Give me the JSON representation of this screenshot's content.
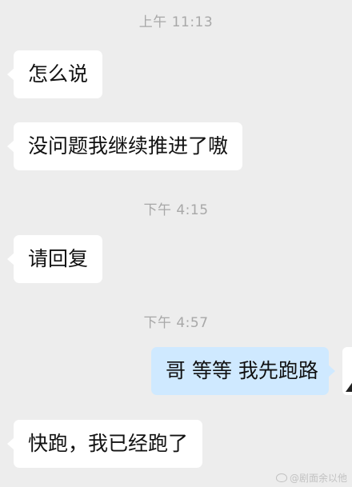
{
  "messages": [
    {
      "type": "timestamp",
      "text": "上午 11:13"
    },
    {
      "type": "incoming",
      "text": "怎么说"
    },
    {
      "type": "incoming",
      "text": "没问题我继续推进了嗷"
    },
    {
      "type": "timestamp",
      "text": "下午 4:15"
    },
    {
      "type": "incoming",
      "text": "请回复"
    },
    {
      "type": "timestamp",
      "text": "下午 4:57"
    },
    {
      "type": "outgoing",
      "text": "哥 等等 我先跑路"
    },
    {
      "type": "incoming",
      "text": "快跑，我已经跑了"
    }
  ],
  "watermark": {
    "icon": "weibo-icon",
    "text": "@剧面余以他"
  },
  "colors": {
    "background": "#ededed",
    "incoming_bubble": "#ffffff",
    "outgoing_bubble": "#cfe9ff",
    "timestamp_text": "#a8a8a8"
  }
}
